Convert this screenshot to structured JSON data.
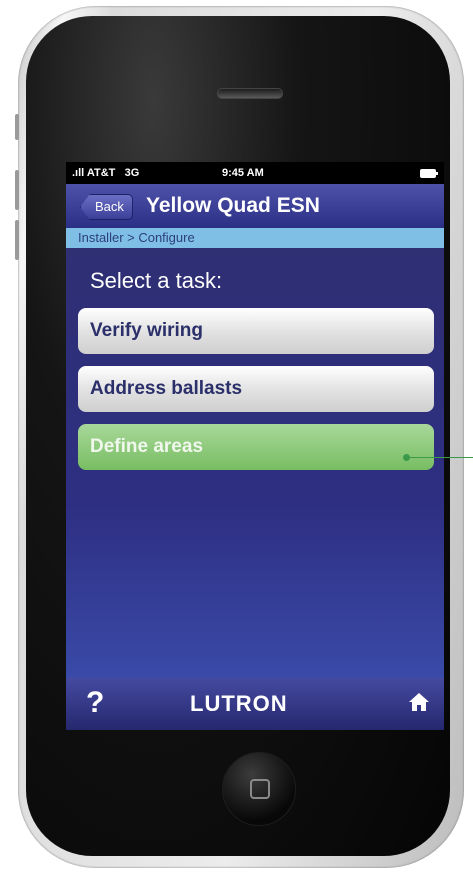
{
  "status_bar": {
    "carrier": "AT&T",
    "network": "3G",
    "time": "9:45 AM"
  },
  "nav": {
    "back_label": "Back",
    "title": "Yellow Quad ESN"
  },
  "breadcrumb": "Installer > Configure",
  "heading": "Select a task:",
  "tasks": [
    {
      "label": "Verify wiring",
      "state": "normal"
    },
    {
      "label": "Address ballasts",
      "state": "normal"
    },
    {
      "label": "Define areas",
      "state": "highlighted"
    }
  ],
  "bottom_bar": {
    "help_label": "?",
    "brand": "LUTRON",
    "home_icon": "home-icon"
  },
  "colors": {
    "nav_blue": "#2c2f86",
    "breadcrumb_blue": "#7fbfe6",
    "highlight_green": "#78bd62",
    "callout_green": "#3a9a4a"
  }
}
